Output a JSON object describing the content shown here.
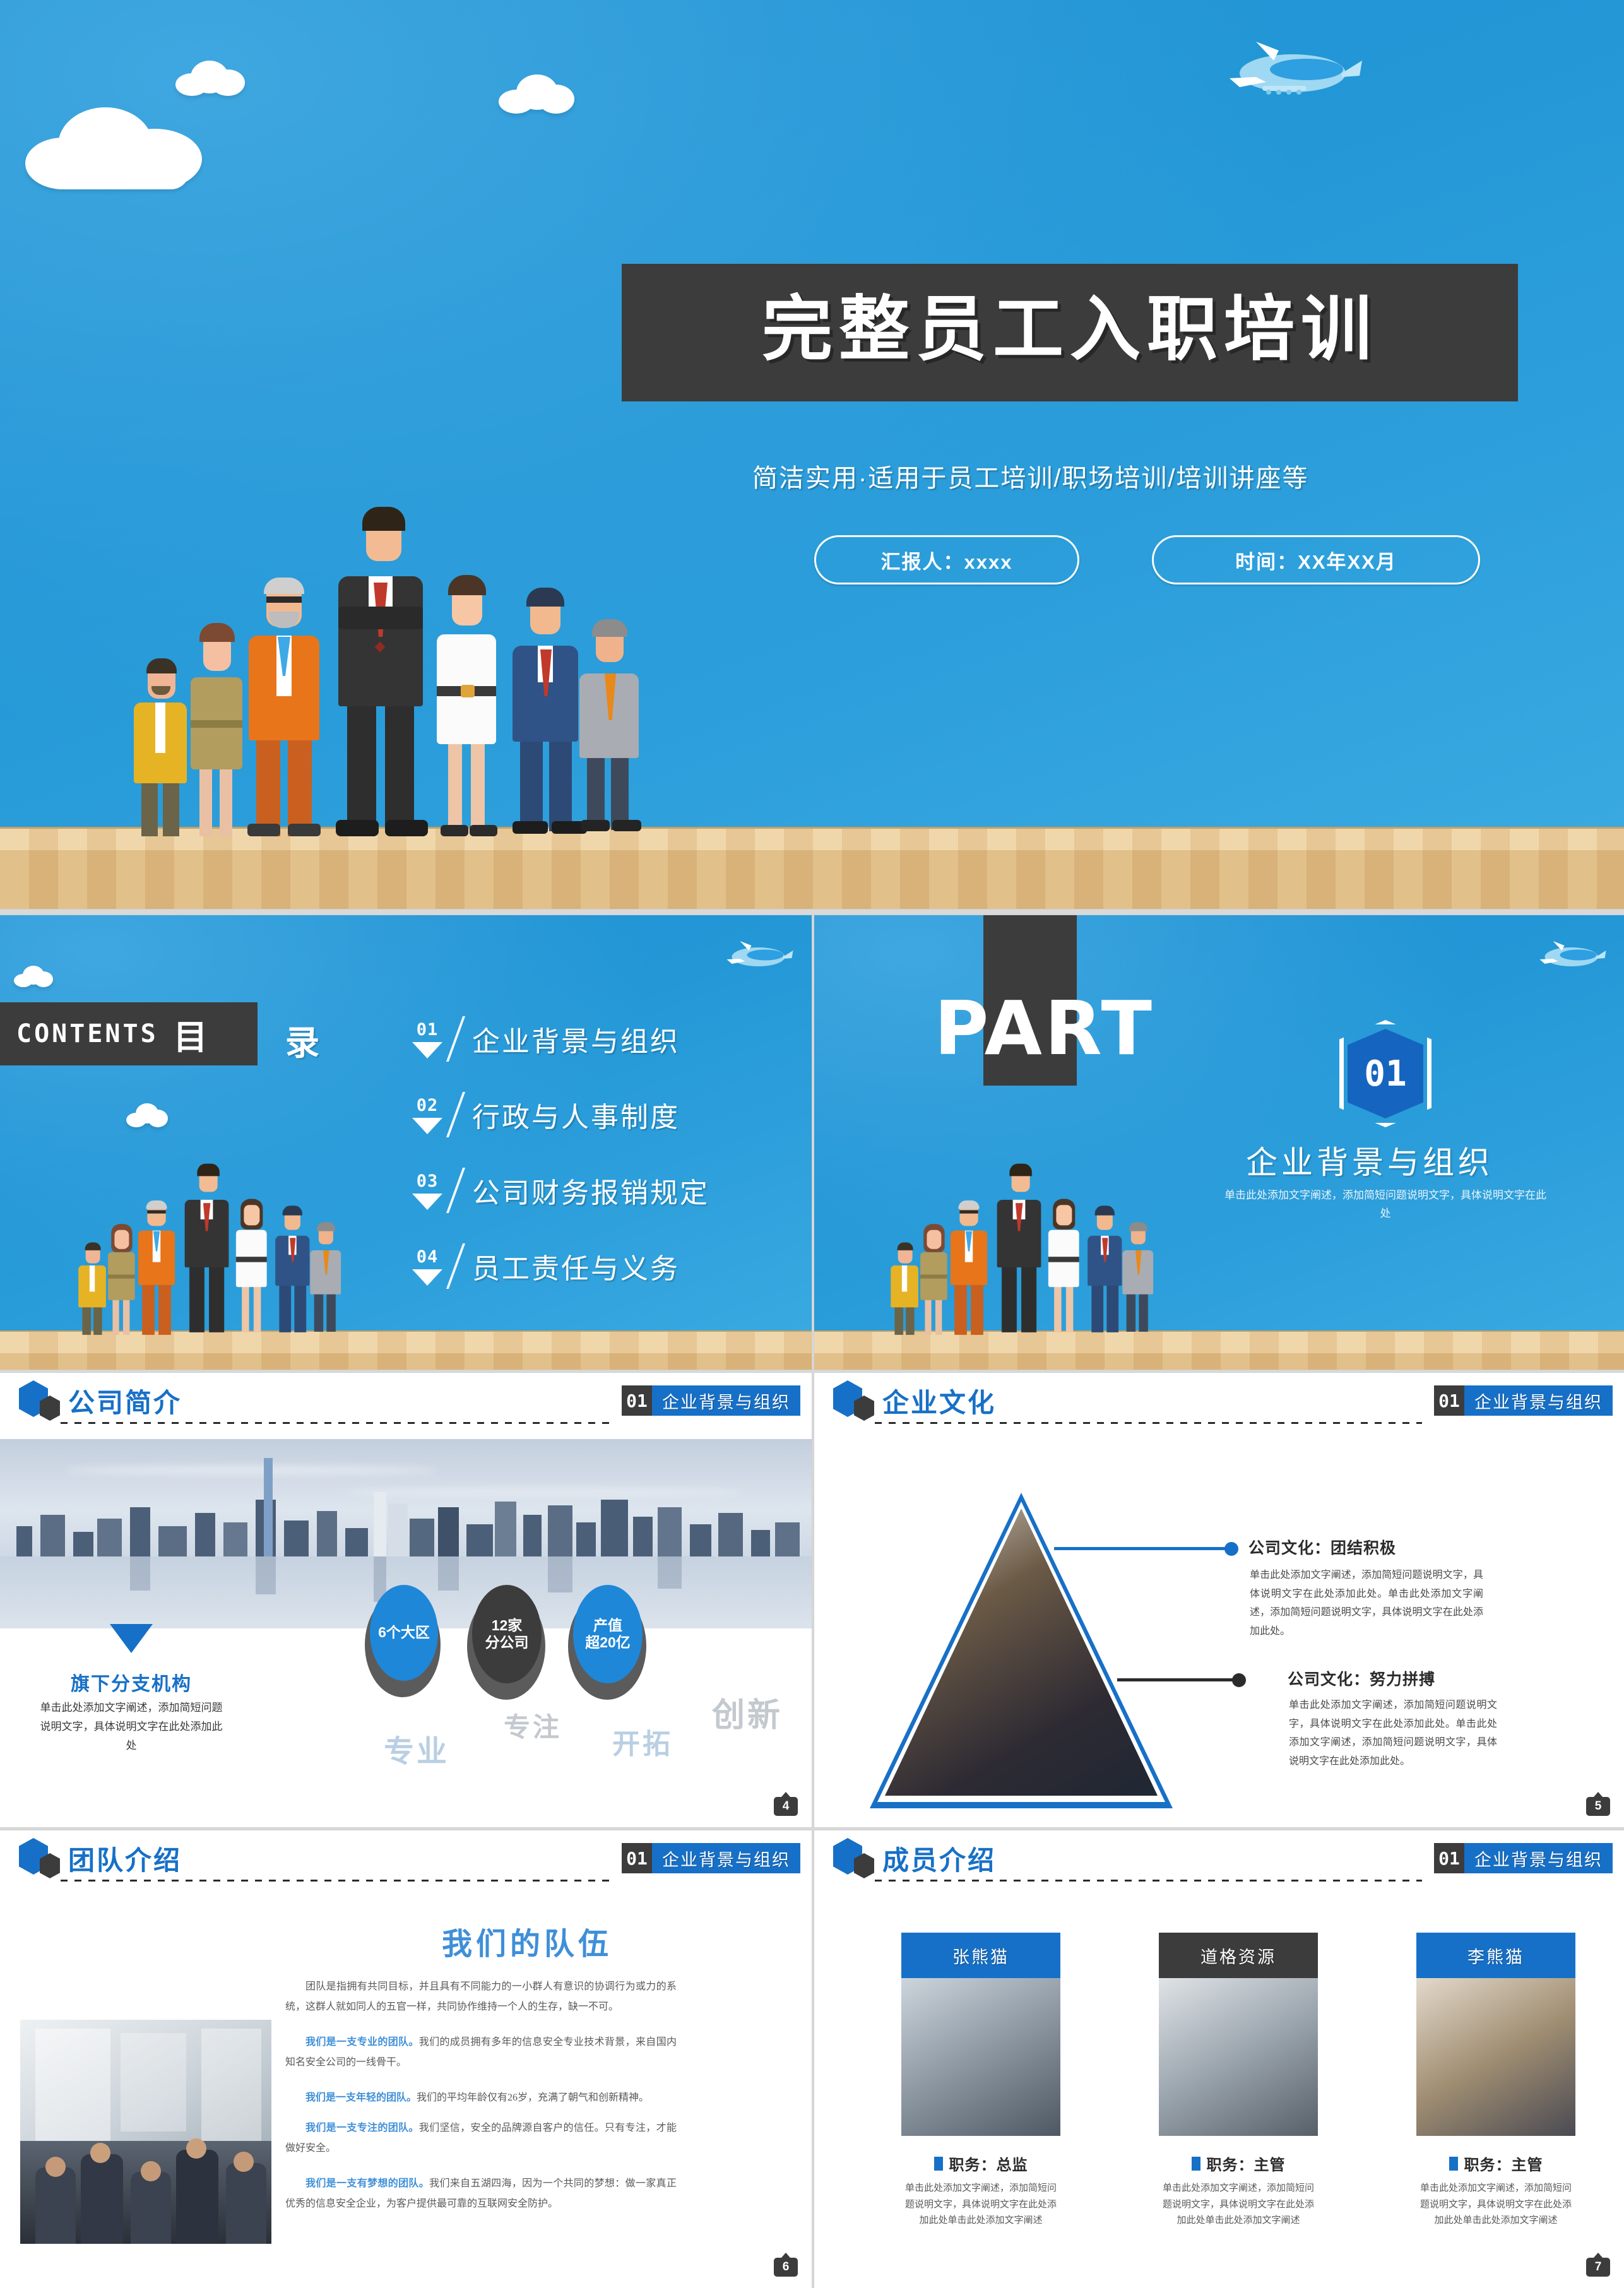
{
  "hero": {
    "title": "完整员工入职培训",
    "subtitle": "简洁实用·适用于员工培训/职场培训/培训讲座等",
    "presenter_pill": "汇报人：xxxx",
    "date_pill": "时间：XX年XX月"
  },
  "contents": {
    "label_en": "CONTENTS",
    "label_cn_1": "目",
    "label_cn_2": "录",
    "items": [
      {
        "num": "01",
        "label": "企业背景与组织"
      },
      {
        "num": "02",
        "label": "行政与人事制度"
      },
      {
        "num": "03",
        "label": "公司财务报销规定"
      },
      {
        "num": "04",
        "label": "员工责任与义务"
      }
    ]
  },
  "part": {
    "word": "PART",
    "number": "01",
    "title": "企业背景与组织",
    "desc": "单击此处添加文字阐述，添加简短问题说明文字，具体说明文字在此处"
  },
  "section_tag": {
    "num": "01",
    "text": "企业背景与组织"
  },
  "slide4": {
    "header": "公司简介",
    "page": "4",
    "caption_title": "旗下分支机构",
    "caption_body": "单击此处添加文字阐述，添加简短问题说明文字，具体说明文字在此处添加此处",
    "ovals": [
      {
        "lines": [
          "6个大区"
        ],
        "color": "#1e87d8"
      },
      {
        "lines": [
          "12家",
          "分公司"
        ],
        "color": "#3c3c3c"
      },
      {
        "lines": [
          "产值",
          "超20亿"
        ],
        "color": "#1e87d8"
      }
    ],
    "bigwords": [
      {
        "text": "专业",
        "color": "#b9cfe3"
      },
      {
        "text": "专注",
        "color": "#c3c9ce"
      },
      {
        "text": "开拓",
        "color": "#b9cfe3"
      },
      {
        "text": "创新",
        "color": "#c3c9ce"
      }
    ]
  },
  "slide5": {
    "header": "企业文化",
    "page": "5",
    "blocks": [
      {
        "title": "公司文化：团结积极",
        "body": "单击此处添加文字阐述，添加简短问题说明文字，具体说明文字在此处添加此处。单击此处添加文字阐述，添加简短问题说明文字，具体说明文字在此处添加此处。",
        "dot_color": "#1770c7"
      },
      {
        "title": "公司文化：努力拼搏",
        "body": "单击此处添加文字阐述，添加简短问题说明文字，具体说明文字在此处添加此处。单击此处添加文字阐述，添加简短问题说明文字，具体说明文字在此处添加此处。",
        "dot_color": "#2b2b2b"
      }
    ]
  },
  "slide6": {
    "header": "团队介绍",
    "page": "6",
    "title": "我们的队伍",
    "paragraphs": [
      {
        "lead": "",
        "text": "团队是指拥有共同目标，并且具有不同能力的一小群人有意识的协调行为或力的系统，这群人就如同人的五官一样，共同协作维持一个人的生存，缺一不可。"
      },
      {
        "lead": "我们是一支专业的团队。",
        "text": "我们的成员拥有多年的信息安全专业技术背景，来自国内知名安全公司的一线骨干。"
      },
      {
        "lead": "我们是一支年轻的团队。",
        "text": "我们的平均年龄仅有26岁，充满了朝气和创新精神。"
      },
      {
        "lead": "我们是一支专注的团队。",
        "text": "我们坚信，安全的品牌源自客户的信任。只有专注，才能做好安全。"
      },
      {
        "lead": "我们是一支有梦想的团队。",
        "text": "我们来自五湖四海，因为一个共同的梦想：做一家真正优秀的信息安全企业，为客户提供最可靠的互联网安全防护。"
      }
    ]
  },
  "slide7": {
    "header": "成员介绍",
    "page": "7",
    "members": [
      {
        "name": "张熊猫",
        "name_bg": "#1770c7",
        "role": "职务：总监",
        "desc": "单击此处添加文字阐述，添加简短问题说明文字，具体说明文字在此处添加此处单击此处添加文字阐述"
      },
      {
        "name": "道格资源",
        "name_bg": "#3c3c3c",
        "role": "职务：主管",
        "desc": "单击此处添加文字阐述，添加简短问题说明文字，具体说明文字在此处添加此处单击此处添加文字阐述"
      },
      {
        "name": "李熊猫",
        "name_bg": "#1770c7",
        "role": "职务：主管",
        "desc": "单击此处添加文字阐述，添加简短问题说明文字，具体说明文字在此处添加此处单击此处添加文字阐述"
      }
    ]
  },
  "theme": {
    "blue": "#1770c7",
    "sky_blue": "#2296d6",
    "dark": "#3c3c3c"
  }
}
